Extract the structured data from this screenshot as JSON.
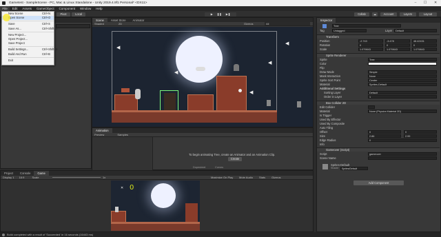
{
  "window": {
    "title": "Gametest - SampleScene - PC, Mac & Linux Standalone - Unity 2019.4.9f1 Personal* <DX11>",
    "min": "–",
    "max": "☐",
    "close": "✕"
  },
  "menubar": [
    "File",
    "Edit",
    "Assets",
    "GameObject",
    "Component",
    "Window",
    "Help"
  ],
  "file_menu": [
    {
      "label": "New Scene",
      "shortcut": "Ctrl+N"
    },
    {
      "label": "Open Scene",
      "shortcut": "Ctrl+O"
    },
    {
      "label": "Save",
      "shortcut": "Ctrl+S"
    },
    {
      "label": "Save As...",
      "shortcut": "Ctrl+Shift+S"
    },
    {
      "label": "New Project...",
      "shortcut": ""
    },
    {
      "label": "Open Project...",
      "shortcut": ""
    },
    {
      "label": "Save Project",
      "shortcut": ""
    },
    {
      "label": "Build Settings...",
      "shortcut": "Ctrl+Shift+B"
    },
    {
      "label": "Build And Run",
      "shortcut": "Ctrl+B"
    },
    {
      "label": "Exit",
      "shortcut": ""
    }
  ],
  "toolbar": {
    "pivot": "Pivot",
    "local": "Local",
    "collab": "Collab",
    "account": "Account",
    "layers": "Layers",
    "layout": "Layout"
  },
  "scene_tabs": [
    "Scene",
    "Asset Store",
    "Animator"
  ],
  "scene_sub": {
    "mode": "Shaded",
    "dim": "2D",
    "gizmos": "Gizmos",
    "search": "All"
  },
  "animation": {
    "tab": "Animation",
    "message": "To begin animating Tree, create an Animator and an Animation Clip.",
    "create": "Create",
    "preview": "Preview",
    "samples": "Samples",
    "dopesheet": "Dopesheet",
    "curves": "Curves"
  },
  "bottom_tabs": [
    "Project",
    "Console",
    "Game"
  ],
  "game_sub": {
    "display": "Display 1",
    "aspect": "16:9",
    "scale_label": "Scale",
    "scale": "1x",
    "max": "Maximize On Play",
    "mute": "Mute Audio",
    "stats": "Stats",
    "gizmos": "Gizmos"
  },
  "game_view": {
    "score": "0"
  },
  "inspector": {
    "tab": "Inspector",
    "name": "Tree",
    "tag_label": "Tag",
    "tag": "Untagged",
    "layer_label": "Layer",
    "layer": "Default",
    "transform": {
      "title": "Transform",
      "position": [
        "-2.743",
        "-3.478",
        "48.42431"
      ],
      "rotation": [
        "0",
        "0",
        "0"
      ],
      "scale": [
        "1.079843",
        "1.079843",
        "1.079843"
      ]
    },
    "sprite_renderer": {
      "title": "Sprite Renderer",
      "sprite": "Tree",
      "draw_mode": "Simple",
      "mask": "None",
      "sort_point": "Center",
      "material": "Sprites-Default",
      "sorting_layer": "Default",
      "order": "1"
    },
    "box_collider": {
      "title": "Box Collider 2D",
      "material": "None (Physics Material 2D)",
      "offset": [
        "0",
        "0"
      ],
      "size": [
        "2.86",
        "2.99"
      ],
      "edge_radius": "0"
    },
    "script": {
      "title": "Gameover (Script)",
      "script": "gameover",
      "scene_name": ""
    },
    "sprites_default": "Sprites-Default",
    "shader_label": "Shader",
    "shader": "Sprites/Default",
    "add_component": "Add Component"
  },
  "labels": {
    "position": "Position",
    "rotation": "Rotation",
    "scale": "Scale",
    "sprite": "Sprite",
    "color": "Color",
    "flip": "Flip",
    "draw_mode": "Draw Mode",
    "mask": "Mask Interaction",
    "sort_point": "Sprite Sort Point",
    "material": "Material",
    "additional": "Additional Settings",
    "sorting_layer": "Sorting Layer",
    "order": "Order in Layer",
    "edit_collider": "Edit Collider",
    "is_trigger": "Is Trigger",
    "used_effector": "Used By Effector",
    "used_composite": "Used By Composite",
    "auto_tiling": "Auto Tiling",
    "offset": "Offset",
    "size": "Size",
    "edge_radius": "Edge Radius",
    "info": "Info",
    "script": "Script",
    "scene_name": "Scene Name"
  },
  "status": "Build completed with a result of 'Succeeded' in 16 seconds (16443 ms)"
}
